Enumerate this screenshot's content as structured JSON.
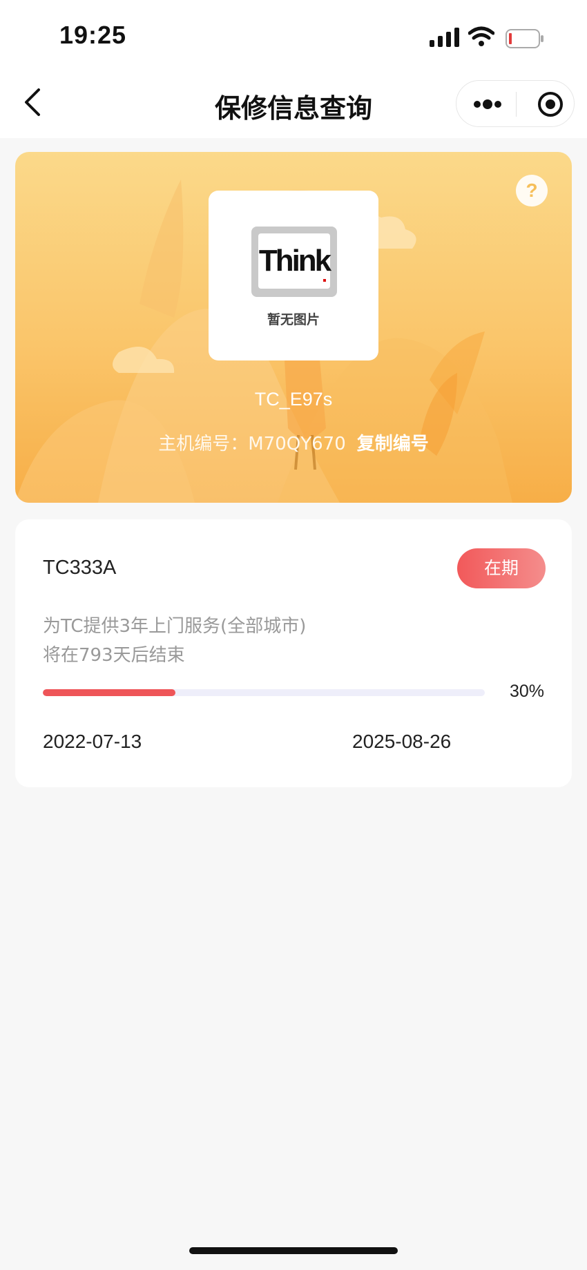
{
  "status_bar": {
    "time": "19:25"
  },
  "nav": {
    "title": "保修信息查询"
  },
  "product": {
    "image_placeholder_label": "暂无图片",
    "logo_text": "Think",
    "model": "TC_E97s",
    "serial_label": "主机编号：",
    "serial_value": "M70QY670",
    "copy_label": "复制编号"
  },
  "warranty": {
    "plan_code": "TC333A",
    "status": "在期",
    "description_line1": "为TC提供3年上门服务(全部城市)",
    "description_line2": "将在793天后结束",
    "progress_percent_text": "30%",
    "progress_fraction": 0.3,
    "start_date": "2022-07-13",
    "end_date": "2025-08-26"
  },
  "colors": {
    "accent_red": "#ee5558",
    "banner_yellow": "#fac56a",
    "track": "#eeeefa"
  },
  "icons": [
    "back-icon",
    "more-icon",
    "target-icon",
    "help-icon",
    "signal-icon",
    "wifi-icon",
    "battery-icon"
  ]
}
